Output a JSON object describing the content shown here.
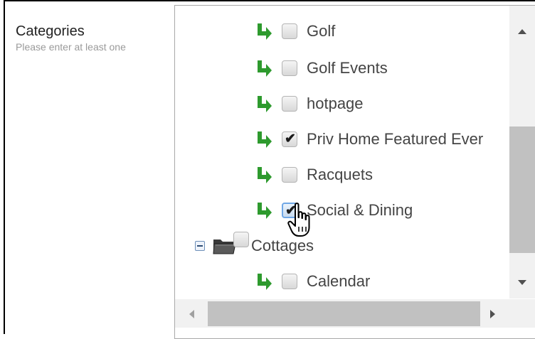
{
  "form": {
    "label": "Categories",
    "hint": "Please enter at least one"
  },
  "tree": {
    "items": [
      {
        "label": "Golf",
        "checked": false,
        "icon": "green-child-arrow-icon"
      },
      {
        "label": "Golf Events",
        "checked": false,
        "icon": "green-child-arrow-icon"
      },
      {
        "label": "hotpage",
        "checked": false,
        "icon": "green-child-arrow-icon"
      },
      {
        "label": "Priv Home Featured Ever",
        "checked": true,
        "icon": "green-child-arrow-icon"
      },
      {
        "label": "Racquets",
        "checked": false,
        "icon": "green-child-arrow-icon"
      },
      {
        "label": "Social & Dining",
        "checked": true,
        "icon": "green-child-arrow-icon"
      },
      {
        "label": "Cottages",
        "checked": false,
        "icon": "folder-icon",
        "expander": "collapse-icon"
      },
      {
        "label": "Calendar",
        "checked": false,
        "icon": "green-child-arrow-icon"
      }
    ]
  },
  "colors": {
    "arrow": "#2e9a2e",
    "focus_border": "#6fa7e6",
    "scroll_thumb": "#c1c1c1",
    "scroll_track": "#f1f1f1"
  },
  "glyphs": {
    "check": "✔"
  }
}
